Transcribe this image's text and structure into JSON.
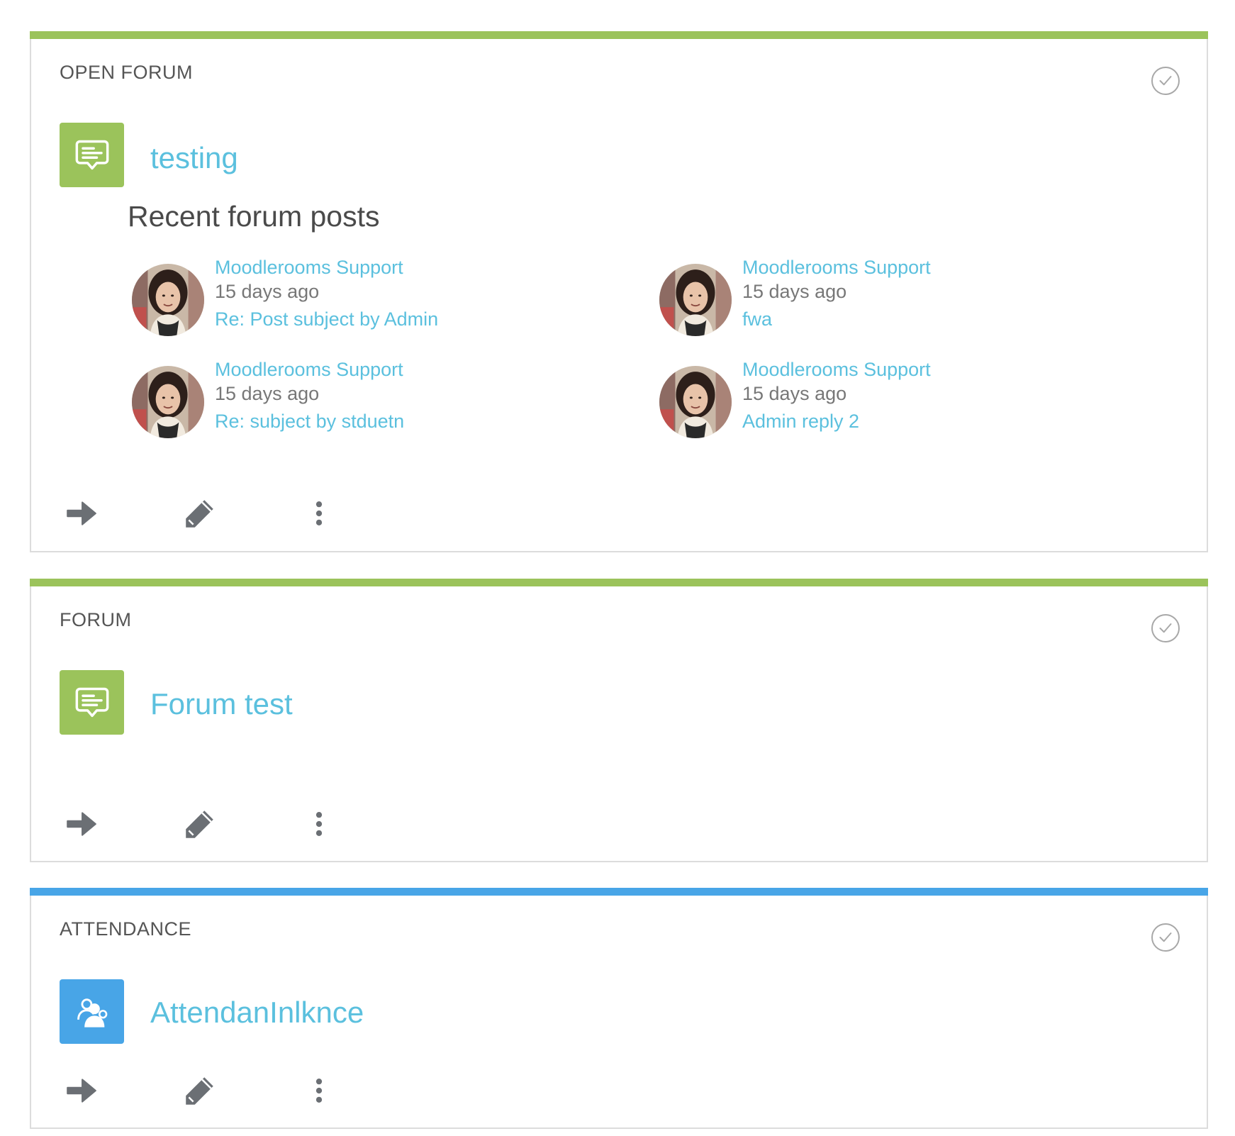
{
  "colors": {
    "forum_accent": "#9bc35b",
    "attendance_accent": "#48a5e7",
    "link": "#5bc0de",
    "icon_gray": "#6b6f74"
  },
  "cards": [
    {
      "type_label": "OPEN FORUM",
      "title": "testing",
      "icon": "forum-speech-bubble-icon",
      "recent_title": "Recent forum posts",
      "posts": [
        {
          "author": "Moodlerooms Support",
          "time": "15 days ago",
          "subject": "Re: Post subject by Admin"
        },
        {
          "author": "Moodlerooms Support",
          "time": "15 days ago",
          "subject": "fwa"
        },
        {
          "author": "Moodlerooms Support",
          "time": "15 days ago",
          "subject": "Re: subject by stduetn"
        },
        {
          "author": "Moodlerooms Support",
          "time": "15 days ago",
          "subject": "Admin reply 2"
        }
      ]
    },
    {
      "type_label": "FORUM",
      "title": "Forum test",
      "icon": "forum-speech-bubble-icon"
    },
    {
      "type_label": "ATTENDANCE",
      "title": "AttendanInlknce",
      "icon": "attendance-people-icon"
    }
  ]
}
